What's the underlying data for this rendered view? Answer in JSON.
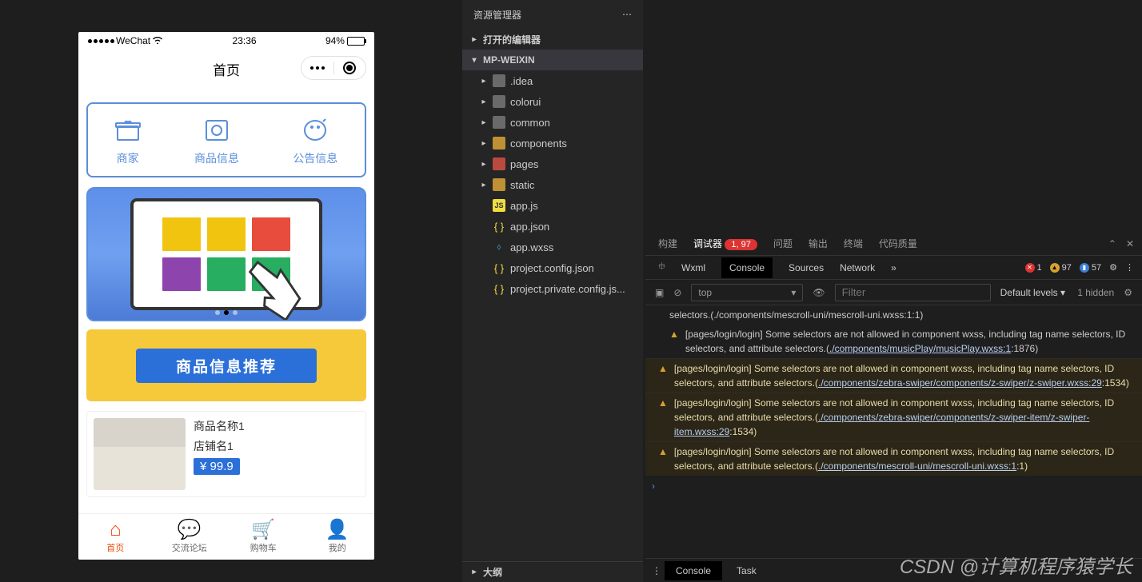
{
  "simulator": {
    "statusBar": {
      "carrier": "WeChat",
      "time": "23:36",
      "batteryPct": "94%"
    },
    "navTitle": "首页",
    "menu": [
      {
        "label": "商家"
      },
      {
        "label": "商品信息"
      },
      {
        "label": "公告信息"
      }
    ],
    "promoTitle": "商品信息推荐",
    "product": {
      "name": "商品名称1",
      "shop": "店铺名1",
      "price": "¥ 99.9"
    },
    "tabs": [
      {
        "label": "首页",
        "active": true
      },
      {
        "label": "交流论坛",
        "active": false
      },
      {
        "label": "购物车",
        "active": false
      },
      {
        "label": "我的",
        "active": false
      }
    ]
  },
  "explorer": {
    "title": "资源管理器",
    "sections": {
      "openEditors": "打开的编辑器",
      "project": "MP-WEIXIN",
      "outline": "大纲"
    },
    "tree": [
      {
        "name": ".idea",
        "type": "folder"
      },
      {
        "name": "colorui",
        "type": "folder"
      },
      {
        "name": "common",
        "type": "folder"
      },
      {
        "name": "components",
        "type": "folder-orange"
      },
      {
        "name": "pages",
        "type": "folder-red"
      },
      {
        "name": "static",
        "type": "folder-orange"
      },
      {
        "name": "app.js",
        "type": "js"
      },
      {
        "name": "app.json",
        "type": "json"
      },
      {
        "name": "app.wxss",
        "type": "wxss"
      },
      {
        "name": "project.config.json",
        "type": "json"
      },
      {
        "name": "project.private.config.js...",
        "type": "json"
      }
    ]
  },
  "devtools": {
    "mainTabs": {
      "build": "构建",
      "debugger": "调试器",
      "badge": "1, 97",
      "issues": "问题",
      "output": "输出",
      "terminal": "终端",
      "codeQuality": "代码质量"
    },
    "subTabs": {
      "wxml": "Wxml",
      "console": "Console",
      "sources": "Sources",
      "network": "Network"
    },
    "counts": {
      "errors": "1",
      "warnings": "97",
      "info": "57"
    },
    "toolbar": {
      "context": "top",
      "filterPlaceholder": "Filter",
      "levels": "Default levels",
      "hidden": "1 hidden"
    },
    "footer": {
      "console": "Console",
      "task": "Task"
    },
    "firstLine": "selectors.(./components/mescroll-uni/mescroll-uni.wxss:1:1)",
    "warnings": [
      {
        "text": "[pages/login/login] Some selectors are not allowed in component wxss, including tag name selectors, ID selectors, and attribute selectors.(",
        "link": "./components/musicPlay/musicPlay.wxss:1",
        "suffix": ":1876)"
      },
      {
        "text": "[pages/login/login] Some selectors are not allowed in component wxss, including tag name selectors, ID selectors, and attribute selectors.(",
        "link": "./components/zebra-swiper/components/z-swiper/z-swiper.wxss:29",
        "suffix": ":1534)"
      },
      {
        "text": "[pages/login/login] Some selectors are not allowed in component wxss, including tag name selectors, ID selectors, and attribute selectors.(",
        "link": "./components/zebra-swiper/components/z-swiper-item/z-swiper-item.wxss:29",
        "suffix": ":1534)"
      },
      {
        "text": "[pages/login/login] Some selectors are not allowed in component wxss, including tag name selectors, ID selectors, and attribute selectors.(",
        "link": "./components/mescroll-uni/mescroll-uni.wxss:1",
        "suffix": ":1)"
      }
    ]
  },
  "watermark": "CSDN @计算机程序猿学长"
}
